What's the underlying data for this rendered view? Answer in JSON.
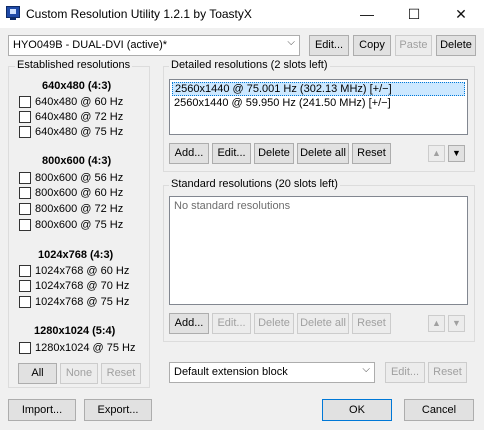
{
  "window": {
    "title": "Custom Resolution Utility 1.2.1 by ToastyX",
    "controls": {
      "minimize": "—",
      "maximize": "☐",
      "close": "✕"
    }
  },
  "monitor": {
    "selected": "HYO049B - DUAL-DVI (active)*",
    "buttons": {
      "edit": "Edit...",
      "copy": "Copy",
      "paste": "Paste",
      "delete": "Delete"
    }
  },
  "established": {
    "title": "Established resolutions",
    "groups": [
      {
        "heading": "640x480 (4:3)",
        "items": [
          "640x480 @ 60 Hz",
          "640x480 @ 72 Hz",
          "640x480 @ 75 Hz"
        ]
      },
      {
        "heading": "800x600 (4:3)",
        "items": [
          "800x600 @ 56 Hz",
          "800x600 @ 60 Hz",
          "800x600 @ 72 Hz",
          "800x600 @ 75 Hz"
        ]
      },
      {
        "heading": "1024x768 (4:3)",
        "items": [
          "1024x768 @ 60 Hz",
          "1024x768 @ 70 Hz",
          "1024x768 @ 75 Hz"
        ]
      },
      {
        "heading": "1280x1024 (5:4)",
        "items": [
          "1280x1024 @ 75 Hz"
        ]
      }
    ],
    "buttons": {
      "all": "All",
      "none": "None",
      "reset": "Reset"
    }
  },
  "detailed": {
    "title": "Detailed resolutions (2 slots left)",
    "items": [
      "2560x1440 @ 75.001 Hz (302.13 MHz) [+/−]",
      "2560x1440 @ 59.950 Hz (241.50 MHz) [+/−]"
    ],
    "buttons": {
      "add": "Add...",
      "edit": "Edit...",
      "delete": "Delete",
      "delete_all": "Delete all",
      "reset": "Reset"
    }
  },
  "standard": {
    "title": "Standard resolutions (20 slots left)",
    "empty_text": "No standard resolutions",
    "buttons": {
      "add": "Add...",
      "edit": "Edit...",
      "delete": "Delete",
      "delete_all": "Delete all",
      "reset": "Reset"
    }
  },
  "arrows": {
    "up": "▲",
    "down": "▼"
  },
  "extension": {
    "selected": "Default extension block",
    "buttons": {
      "edit": "Edit...",
      "reset": "Reset"
    }
  },
  "footer": {
    "import": "Import...",
    "export": "Export...",
    "ok": "OK",
    "cancel": "Cancel"
  },
  "icons": {
    "combo_arrow": "⌵"
  }
}
